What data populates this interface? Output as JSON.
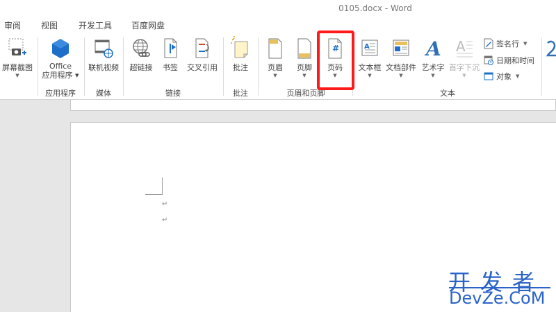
{
  "window": {
    "title": "0105.docx - Word"
  },
  "tabs": [
    "审阅",
    "视图",
    "开发工具",
    "百度网盘"
  ],
  "ribbon": {
    "buttons": {
      "screenshot": "屏幕截图",
      "office_apps_line1": "Office",
      "office_apps_line2": "应用程序",
      "online_video": "联机视频",
      "hyperlink": "超链接",
      "bookmark": "书签",
      "cross_reference": "交叉引用",
      "comment": "批注",
      "header": "页眉",
      "footer": "页脚",
      "page_number": "页码",
      "page_number_glyph": "#",
      "text_box": "文本框",
      "quick_parts": "文档部件",
      "wordart": "艺术字",
      "drop_cap": "首字下沉",
      "signature_line": "签名行",
      "date_time": "日期和时间",
      "object": "对象"
    },
    "groups": {
      "apps": "应用程序",
      "media": "媒体",
      "links": "链接",
      "comments": "批注",
      "header_footer": "页眉和页脚",
      "text": "文本"
    }
  },
  "document": {
    "paragraph_mark": "↵"
  },
  "watermark": {
    "chinese": "开发者",
    "english": "DevZe.CoM"
  },
  "colors": {
    "highlight_border": "#ff1a1a",
    "watermark": "#2a63c8",
    "accent_blue": "#1e6fc9"
  }
}
